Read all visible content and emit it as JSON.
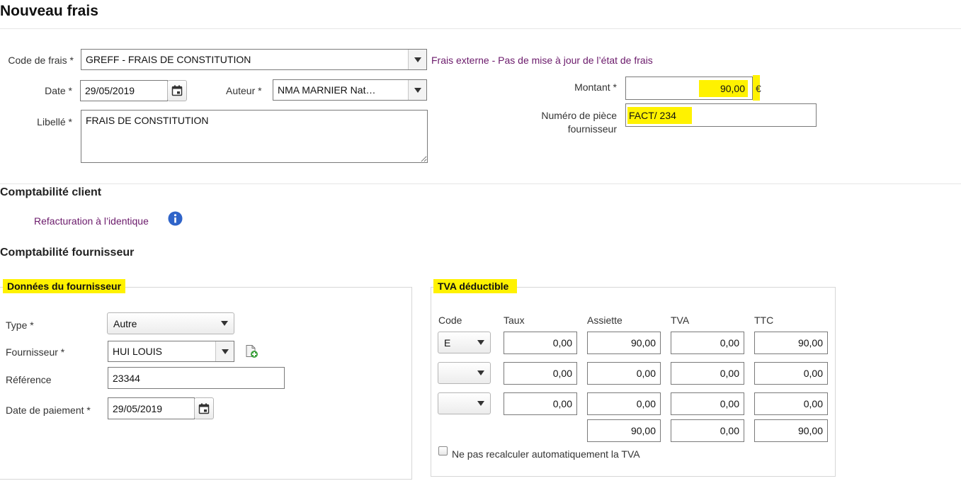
{
  "page": {
    "title": "Nouveau frais"
  },
  "frais": {
    "code_label": "Code de frais *",
    "code_value": "GREFF - FRAIS DE CONSTITUTION",
    "code_note": "Frais externe - Pas de mise à jour de l’état de frais",
    "date_label": "Date *",
    "date_value": "29/05/2019",
    "auteur_label": "Auteur *",
    "auteur_value": "NMA MARNIER Nat…",
    "libelle_label": "Libellé *",
    "libelle_value": "FRAIS DE CONSTITUTION",
    "montant_label": "Montant *",
    "montant_value": "90,00",
    "currency": "€",
    "piece_label_1": "Numéro de pièce",
    "piece_label_2": "fournisseur",
    "piece_value": "FACT/ 234"
  },
  "client": {
    "heading": "Comptabilité client",
    "refacturation": "Refacturation à l’identique",
    "info_icon": "info-icon"
  },
  "fournisseur": {
    "heading": "Comptabilité fournisseur",
    "legend": "Données du fournisseur",
    "type_label": "Type *",
    "type_value": "Autre",
    "fournisseur_label": "Fournisseur *",
    "fournisseur_value": "HUI LOUIS",
    "reference_label": "Référence",
    "reference_value": "23344",
    "date_paiement_label": "Date de paiement *",
    "date_paiement_value": "29/05/2019"
  },
  "tva": {
    "legend": "TVA déductible",
    "headers": [
      "Code",
      "Taux",
      "Assiette",
      "TVA",
      "TTC"
    ],
    "rows": [
      {
        "code": "E",
        "taux": "0,00",
        "assiette": "90,00",
        "tva": "0,00",
        "ttc": "90,00"
      },
      {
        "code": "",
        "taux": "0,00",
        "assiette": "0,00",
        "tva": "0,00",
        "ttc": "0,00"
      },
      {
        "code": "",
        "taux": "0,00",
        "assiette": "0,00",
        "tva": "0,00",
        "ttc": "0,00"
      }
    ],
    "totals": {
      "assiette": "90,00",
      "tva": "0,00",
      "ttc": "90,00"
    },
    "checkbox_label": "Ne pas recalculer automatiquement la TVA"
  },
  "colors": {
    "highlight": "#fff200",
    "link": "#6b1a6b",
    "info": "#2f64c9"
  }
}
